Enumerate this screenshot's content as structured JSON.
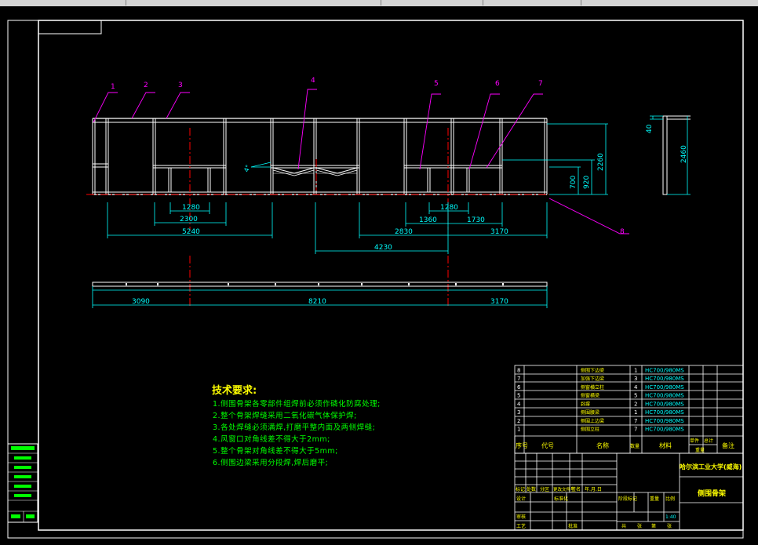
{
  "balloons": [
    "1",
    "2",
    "3",
    "4",
    "5",
    "6",
    "7",
    "8"
  ],
  "dims": {
    "d1280a": "1280",
    "d2300": "2300",
    "d5240": "5240",
    "d2830": "2830",
    "d4230": "4230",
    "d1360": "1360",
    "d1280b": "1280",
    "d1730": "1730",
    "d3170a": "3170",
    "d700": "700",
    "d920": "920",
    "d2260": "2260",
    "d40": "40",
    "d2460": "2460",
    "d3090": "3090",
    "d8210": "8210",
    "d3170b": "3170",
    "angle": "4°"
  },
  "tech": {
    "title": "技术要求:",
    "lines": [
      "1.侧围骨架各零部件组焊前必须作磷化防腐处理;",
      "2.整个骨架焊缝采用二氧化碳气体保护焊;",
      "3.各处焊缝必须满焊,打磨平整内面及两侧焊缝;",
      "4.风窗口对角线差不得大于2mm;",
      "5.整个骨架对角线差不得大于5mm;",
      "6.侧围边梁采用分段焊,焊后磨平;"
    ]
  },
  "bom": {
    "rows": [
      {
        "no": "8",
        "name": "侧围下边梁",
        "qty": "1",
        "mat": "HC700/980MS"
      },
      {
        "no": "7",
        "name": "加强下边梁",
        "qty": "3",
        "mat": "HC700/980MS"
      },
      {
        "no": "6",
        "name": "侧窗横立柱",
        "qty": "4",
        "mat": "HC700/980MS"
      },
      {
        "no": "5",
        "name": "侧窗横梁",
        "qty": "5",
        "mat": "HC700/980MS"
      },
      {
        "no": "4",
        "name": "斜撑",
        "qty": "2",
        "mat": "HC700/980MS"
      },
      {
        "no": "3",
        "name": "侧围腰梁",
        "qty": "1",
        "mat": "HC700/980MS"
      },
      {
        "no": "2",
        "name": "侧围上边梁",
        "qty": "7",
        "mat": "HC700/980MS"
      },
      {
        "no": "1",
        "name": "侧围立柱",
        "qty": "7",
        "mat": "HC700/980MS"
      }
    ],
    "header": {
      "no": "序号",
      "code": "代号",
      "name": "名称",
      "qty": "数量",
      "mat": "材料",
      "unit": "单件",
      "total": "总计",
      "weight": "重量",
      "remark": "备注"
    }
  },
  "titleblock": {
    "university": "哈尔滨工业大学(威海)",
    "drawing_name": "侧围骨架",
    "mark": "标记",
    "count": "处数",
    "zone": "分区",
    "change_doc": "更改文件号",
    "sign": "签名",
    "date": "年.月.日",
    "design": "设计",
    "standardize": "标准化",
    "stage": "阶段标记",
    "weight": "重量",
    "scale": "比例",
    "scale_val": "1:40",
    "review": "审核",
    "process": "工艺",
    "approve": "批准",
    "sheets": "共",
    "sheet": "张",
    "page": "第",
    "page2": "张"
  },
  "colors": {
    "frame": "#ffffff",
    "cyan": "#00ffff",
    "magenta": "#ff00ff",
    "red": "#ff0000",
    "green": "#00ff00",
    "yellow": "#ffff00"
  }
}
